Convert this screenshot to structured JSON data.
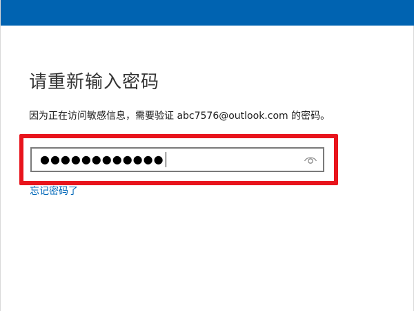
{
  "dialog": {
    "heading": "请重新输入密码",
    "info_text": "因为正在访问敏感信息，需要验证 abc7576@outlook.com 的密码。",
    "password_field": {
      "masked_value": "●●●●●●●●●●●●",
      "reveal_icon": "eye-icon"
    },
    "forgot_link": "忘记密码了"
  },
  "colors": {
    "title_bar": "#0063b1",
    "highlight": "#e8141c",
    "link": "#0067b8"
  }
}
